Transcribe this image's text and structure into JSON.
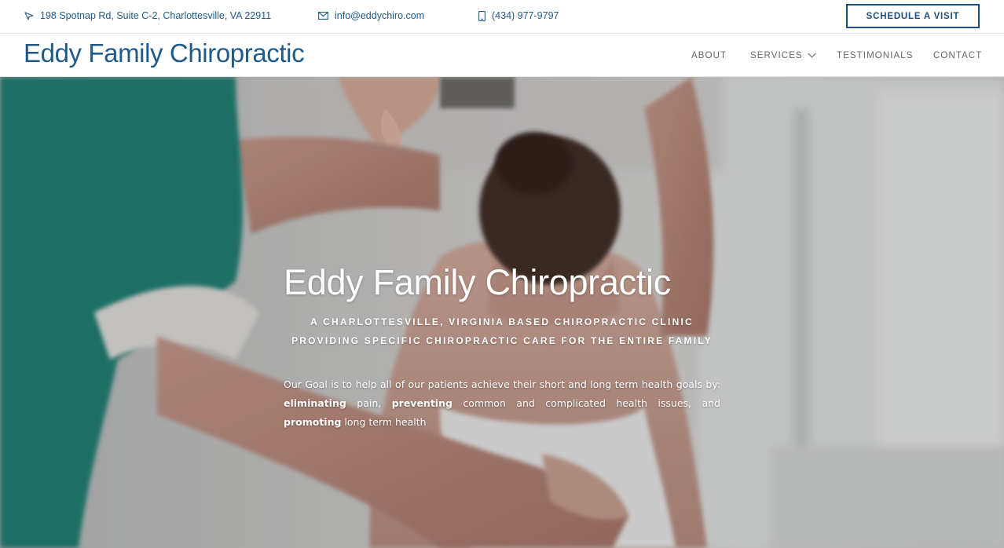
{
  "topbar": {
    "address": "198 Spotnap Rd, Suite C-2, Charlottesville, VA 22911",
    "email": "info@eddychiro.com",
    "phone": "(434) 977-9797",
    "schedule_label": "SCHEDULE A VISIT",
    "icons": [
      "location-arrow-icon",
      "envelope-icon",
      "mobile-phone-icon"
    ]
  },
  "header": {
    "logo": "Eddy Family Chiropractic",
    "nav": {
      "about": "ABOUT",
      "services": "SERVICES",
      "testimonials": "TESTIMONIALS",
      "contact": "CONTACT"
    }
  },
  "hero": {
    "title": "Eddy Family Chiropractic",
    "subtitle": "A CHARLOTTESVILLE, VIRGINIA BASED CHIROPRACTIC CLINIC PROVIDING SPECIFIC CHIROPRACTIC CARE FOR THE ENTIRE FAMILY",
    "body_intro": "Our Goal is to help all of our patients achieve their short and long term health goals by:",
    "body_word1": "eliminating",
    "body_text1": " pain, ",
    "body_word2": "preventing",
    "body_text2": " common and complicated health issues, and ",
    "body_word3": "promoting",
    "body_text3": " long term health"
  },
  "colors": {
    "brand_blue": "#1e5a8a",
    "button_border": "#1c4f7c",
    "nav_text": "#666666"
  }
}
